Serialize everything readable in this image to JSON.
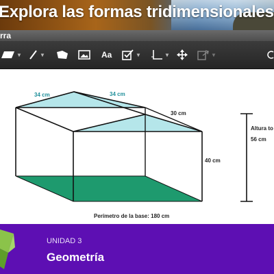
{
  "banner": {
    "title": "Explora las formas tridimensionales"
  },
  "subbar": {
    "label": "rra"
  },
  "toolbar": {
    "tools": [
      "polygon-tool",
      "line-tool",
      "shape-tool",
      "image-tool",
      "text-tool",
      "checkbox-tool",
      "axis-tool",
      "move-tool",
      "export-tool",
      "undo-tool"
    ],
    "text_tool_label": "Aa"
  },
  "figure": {
    "edge_top_left": "34 cm",
    "edge_top_right": "34 cm",
    "depth": "30 cm",
    "height": "40 cm",
    "total_height_label": "Altura to",
    "total_height_value": "56 cm",
    "perimeter": "Perímetro de la base: 180 cm",
    "colors": {
      "roof": "#b5e6ea",
      "base": "#1e9a6e",
      "edge": "#111111"
    }
  },
  "footer": {
    "unit": "UNIDAD 3",
    "subject": "Geometría",
    "accent": "#5d0fb3",
    "logo_color": "#8bc34a"
  }
}
